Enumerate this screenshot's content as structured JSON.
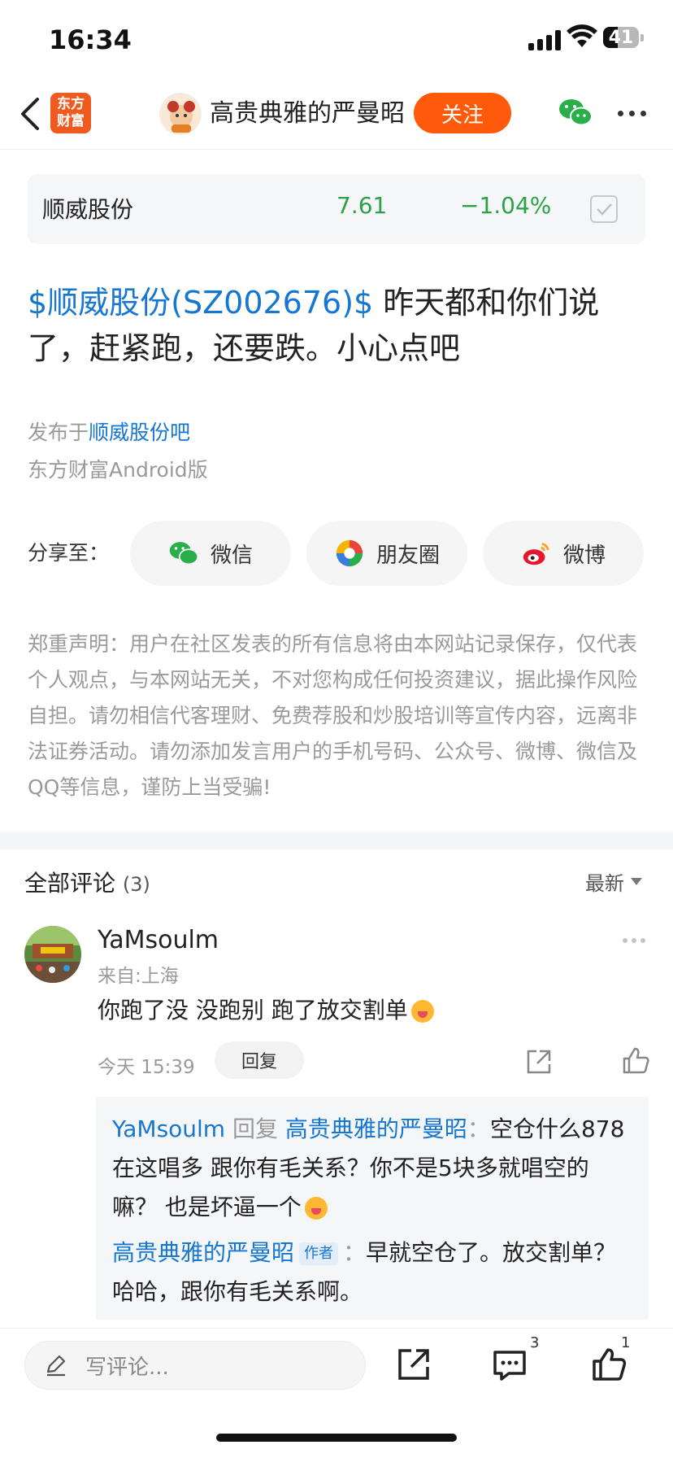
{
  "status_bar": {
    "time": "16:34",
    "battery": "41",
    "battery_level": 0.41
  },
  "nav": {
    "back_icon": "chevron-left-icon",
    "app_logo_line1": "东方",
    "app_logo_line2": "财富",
    "user_name": "高贵典雅的严曼昭",
    "follow_label": "关注",
    "wechat_icon": "wechat-icon",
    "more_icon": "more-horizontal-icon"
  },
  "stock": {
    "name": "顺威股份",
    "price": "7.61",
    "change": "−1.04%",
    "color_down": "#2ba245"
  },
  "post": {
    "tag": "$顺威股份(SZ002676)$",
    "text": " 昨天都和你们说了，赶紧跑，还要跌。小心点吧",
    "published_prefix": "发布于",
    "forum_link": "顺威股份吧",
    "client": "东方财富Android版"
  },
  "share": {
    "label": "分享至：",
    "wechat": "微信",
    "moments": "朋友圈",
    "weibo": "微博"
  },
  "disclaimer": "郑重声明：用户在社区发表的所有信息将由本网站记录保存，仅代表个人观点，与本网站无关，不对您构成任何投资建议，据此操作风险自担。请勿相信代客理财、免费荐股和炒股培训等宣传内容，远离非法证券活动。请勿添加发言用户的手机号码、公众号、微博、微信及QQ等信息，谨防上当受骗!",
  "comments": {
    "title": "全部评论",
    "count": "(3)",
    "sort": "最新",
    "items": [
      {
        "user": "YaMsoulm",
        "location": "来自:上海",
        "text": "你跑了没 没跑别 跑了放交割单",
        "time": "今天 15:39",
        "reply_label": "回复",
        "replies": [
          {
            "from": "YaMsoulm",
            "verb": " 回复 ",
            "to": "高贵典雅的严曼昭",
            "sep": "：",
            "text": "空仓什么878 在这唱多 跟你有毛关系？你不是5块多就唱空的嘛？ 也是坏逼一个"
          },
          {
            "from": "高贵典雅的严曼昭",
            "badge": "作者",
            "sep": "：",
            "text": "早就空仓了。放交割单？哈哈，跟你有毛关系啊。"
          }
        ]
      }
    ]
  },
  "bottom_bar": {
    "placeholder": "写评论...",
    "comment_count": "3",
    "like_count": "1"
  },
  "colors": {
    "accent": "#ff5a0a",
    "link": "#1677d2",
    "green": "#2ba245"
  }
}
